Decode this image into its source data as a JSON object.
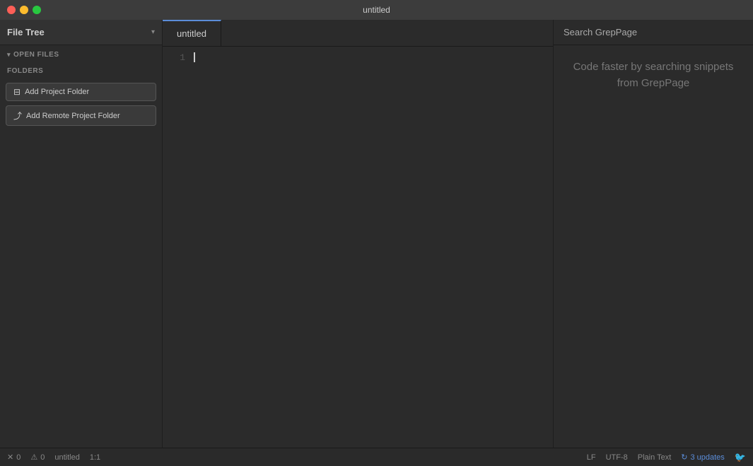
{
  "titleBar": {
    "title": "untitled",
    "buttons": {
      "close": "close",
      "minimize": "minimize",
      "maximize": "maximize"
    }
  },
  "sidebar": {
    "title": "File Tree",
    "openFilesLabel": "Open Files",
    "foldersLabel": "Folders",
    "addProjectFolder": "Add Project Folder",
    "addRemoteProjectFolder": "Add Remote Project Folder"
  },
  "editor": {
    "activeTab": "untitled",
    "tabs": [
      {
        "label": "untitled",
        "active": true
      }
    ],
    "lineNumbers": [
      "1"
    ],
    "content": ""
  },
  "rightPanel": {
    "title": "Search GrepPage",
    "promoText": "Code faster by searching snippets from GrepPage"
  },
  "statusBar": {
    "errors": "0",
    "warnings": "0",
    "filename": "untitled",
    "position": "1:1",
    "lineEnding": "LF",
    "encoding": "UTF-8",
    "language": "Plain Text",
    "updates": "3 updates"
  }
}
